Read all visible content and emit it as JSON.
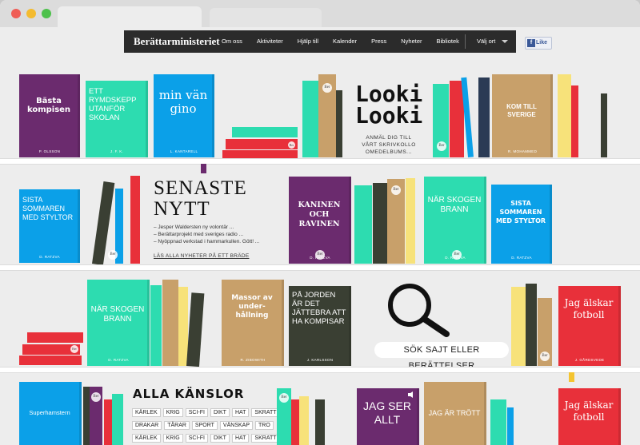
{
  "nav": {
    "brand": "Berättarministeriet",
    "links": [
      "Om oss",
      "Aktiviteter",
      "Hjälp till",
      "Kalender",
      "Press",
      "Nyheter",
      "Bibliotek"
    ],
    "region": "Välj ort",
    "like": "Like"
  },
  "books": {
    "b1": {
      "title": "Bästa kompisen",
      "author": "P. OLSSON"
    },
    "b2": {
      "title": "ETT RYMDSKEPP UTANFÖR SKOLAN",
      "author": "J. F. K."
    },
    "b3": {
      "title": "min vän gino",
      "author": "L. KANTARELL"
    },
    "b4": {
      "title": "KOM TILL SVERIGE",
      "author": "R. MOHAMMED"
    },
    "b5": {
      "title": "SISTA SOMMAREN MED STYLTOR",
      "author": "D. RATZVA"
    },
    "b6": {
      "title": "KANINEN OCH RAVINEN",
      "author": "D. RATZVA"
    },
    "b7": {
      "title": "NÄR SKOGEN BRANN",
      "author": "D. RATZVA"
    },
    "b8": {
      "title": "SISTA SOMMAREN MED STYLTOR",
      "author": "D. RATZVA"
    },
    "b9": {
      "title": "NÄR SKOGEN BRANN",
      "author": "D. RATZVA"
    },
    "b10": {
      "title": "Massor av under-hållning",
      "author": "R. ZIBOWITH"
    },
    "b11": {
      "title": "PÅ JORDEN ÄR DET JÄTTEBRA ATT HA KOMPISAR",
      "author": "J. KARLSSON"
    },
    "b12": {
      "title": "Jag älskar fotboll",
      "author": "J. GÅRDSVEDE"
    },
    "b13": {
      "title": "Superhamstern"
    },
    "b14": {
      "title": "JAG SER ALLT"
    },
    "b15": {
      "title": "JAG ÄR TRÖTT"
    },
    "b16": {
      "title": "Jag älskar fotboll"
    }
  },
  "seal": "Ber",
  "looki": {
    "title_line1": "Looki",
    "title_line2": "Looki",
    "caption_line1": "ANMÄL DIG TILL",
    "caption_line2": "VÅRT SKRIVKOLLO",
    "caption_line3": "OMEDELBUMS..."
  },
  "news": {
    "title_line1": "SENASTE",
    "title_line2": "NYTT",
    "items": [
      "– Jesper Waldersten ny volontär ...",
      "– Berättarprojekt med sveriges radio ...",
      "– Nyöppnad verkstad i hammarkullen. Gött! ..."
    ],
    "link": "LÄS ALLA NYHETER PÅ ETT BRÄDE"
  },
  "search": {
    "label": "SÖK SAJT ELLER BERÄTTELSER"
  },
  "feelings": {
    "title": "ALLA KÄNSLOR",
    "row1": [
      "KÄRLEK",
      "KRIG",
      "SCI-FI",
      "DIKT",
      "HAT",
      "SKRATT"
    ],
    "row2": [
      "DRAKAR",
      "TÅRAR",
      "SPORT",
      "VÄNSKAP",
      "TRO"
    ],
    "row3": [
      "KÄRLEK",
      "KRIG",
      "SCI-FI",
      "DIKT",
      "HAT",
      "SKRATT"
    ]
  },
  "colors": {
    "purple": "#6b2b6e",
    "teal": "#2ddcb0",
    "blue": "#0ba0e8",
    "tan": "#c8a06a",
    "red": "#e8303a",
    "dark": "#3a3f33",
    "yellow": "#f7e27a",
    "navy": "#2b2b2b"
  }
}
